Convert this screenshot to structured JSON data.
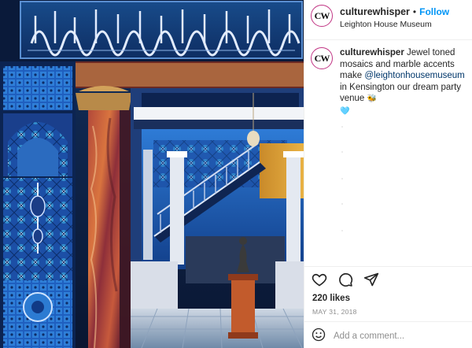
{
  "post": {
    "username": "culturewhisper",
    "avatar_initials": "CW",
    "follow_label": "Follow",
    "separator": "•",
    "location": "Leighton House Museum",
    "caption": {
      "username": "culturewhisper",
      "text_before": "Jewel toned mosaics and marble accents make",
      "mention": "@leightonhousemuseum",
      "text_after": "in Kensington our dream party venue",
      "emojis": "🐝",
      "emoji_heart": "🩵"
    },
    "likes": "220 likes",
    "date": "MAY 31, 2018",
    "comment_placeholder": "Add a comment..."
  },
  "icons": {
    "like": "heart-icon",
    "comment": "comment-bubble-icon",
    "share": "paper-plane-icon",
    "emoji": "smiley-icon"
  },
  "colors": {
    "follow": "#0095f6",
    "mention": "#00376b",
    "muted": "#8e8e8e",
    "avatar_ring": "#c13584"
  }
}
